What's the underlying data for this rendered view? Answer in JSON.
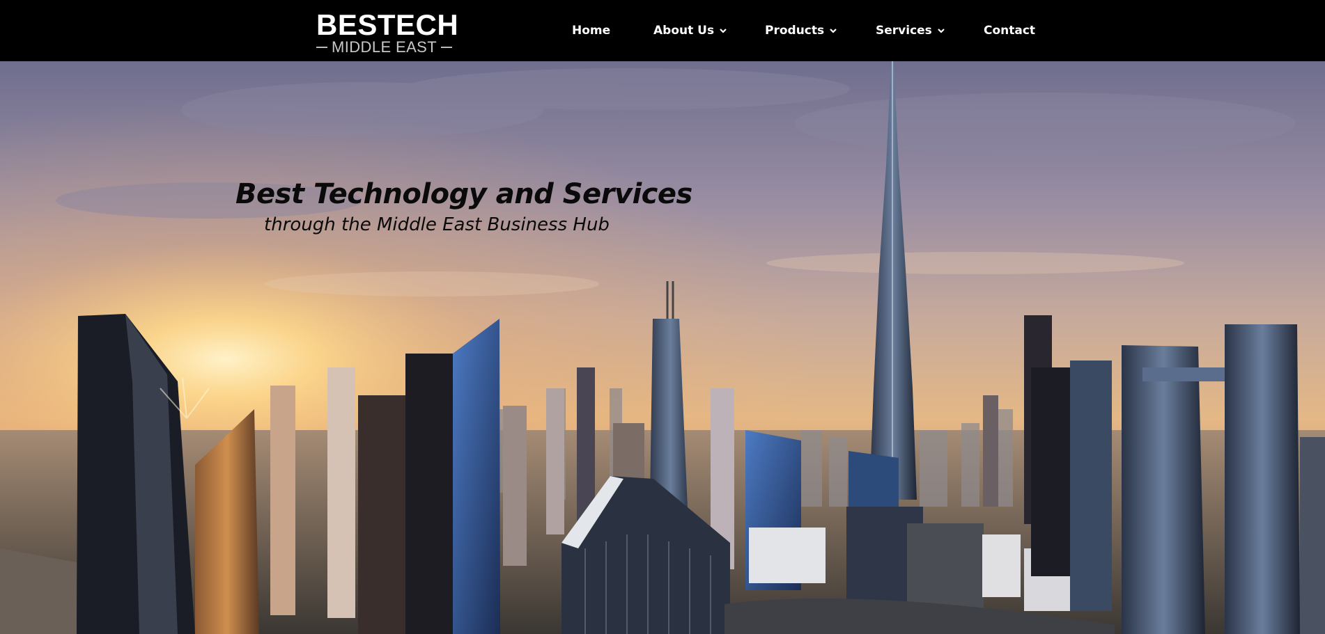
{
  "brand": {
    "name": "BESTECH",
    "tagline": "MIDDLE EAST"
  },
  "nav": {
    "items": [
      {
        "label": "Home",
        "has_dropdown": false
      },
      {
        "label": "About Us",
        "has_dropdown": true
      },
      {
        "label": "Products",
        "has_dropdown": true
      },
      {
        "label": "Services",
        "has_dropdown": true
      },
      {
        "label": "Contact",
        "has_dropdown": false
      }
    ]
  },
  "hero": {
    "headline": "Best Technology and Services",
    "subheadline": "through the Middle East Business Hub",
    "background_image": "Dubai skyline at sunset"
  },
  "colors": {
    "header_bg": "#000000",
    "nav_text": "#ffffff",
    "headline_text": "#0a0a0a",
    "sky_top": "#6f6e8e",
    "sun_glow": "#ffd88a"
  }
}
